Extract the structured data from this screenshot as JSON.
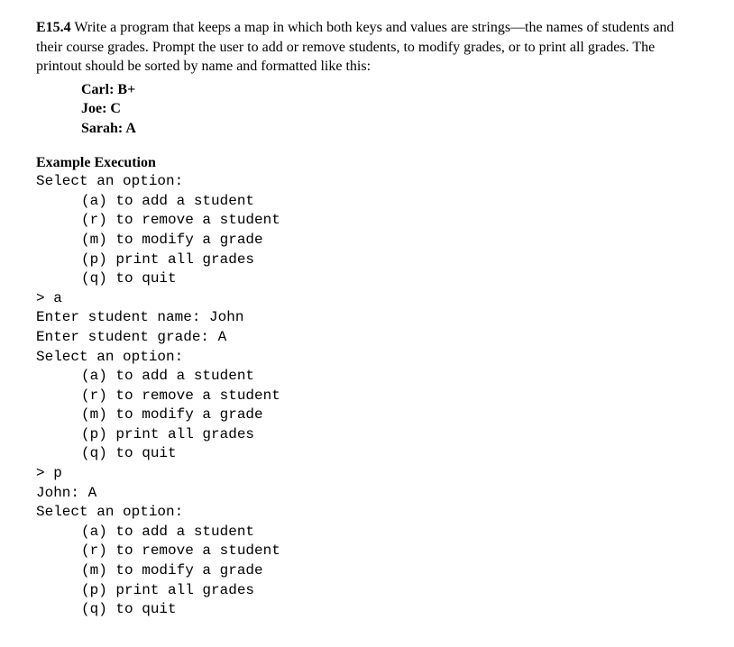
{
  "problem": {
    "label": "E15.4",
    "text_part1": " Write a program that keeps a map in which both keys and values are strings—the names of students and their course grades. Prompt the user to add or remove students, to modify grades, or to print all grades. The printout should be sorted by name and formatted like this:",
    "examples": [
      "Carl: B+",
      "Joe: C",
      "Sarah: A"
    ]
  },
  "execution": {
    "heading": "Example Execution",
    "lines": [
      {
        "indent": 0,
        "text": "Select an option:"
      },
      {
        "indent": 1,
        "text": "(a) to add a student"
      },
      {
        "indent": 1,
        "text": "(r) to remove a student"
      },
      {
        "indent": 1,
        "text": "(m) to modify a grade"
      },
      {
        "indent": 1,
        "text": "(p) print all grades"
      },
      {
        "indent": 1,
        "text": "(q) to quit"
      },
      {
        "indent": 0,
        "text": "> a"
      },
      {
        "indent": 0,
        "text": "Enter student name: John"
      },
      {
        "indent": 0,
        "text": "Enter student grade: A"
      },
      {
        "indent": 0,
        "text": "Select an option:"
      },
      {
        "indent": 1,
        "text": "(a) to add a student"
      },
      {
        "indent": 1,
        "text": "(r) to remove a student"
      },
      {
        "indent": 1,
        "text": "(m) to modify a grade"
      },
      {
        "indent": 1,
        "text": "(p) print all grades"
      },
      {
        "indent": 1,
        "text": "(q) to quit"
      },
      {
        "indent": 0,
        "text": "> p"
      },
      {
        "indent": 0,
        "text": "John: A"
      },
      {
        "indent": 0,
        "text": "Select an option:"
      },
      {
        "indent": 1,
        "text": "(a) to add a student"
      },
      {
        "indent": 1,
        "text": "(r) to remove a student"
      },
      {
        "indent": 1,
        "text": "(m) to modify a grade"
      },
      {
        "indent": 1,
        "text": "(p) print all grades"
      },
      {
        "indent": 1,
        "text": "(q) to quit"
      }
    ]
  }
}
